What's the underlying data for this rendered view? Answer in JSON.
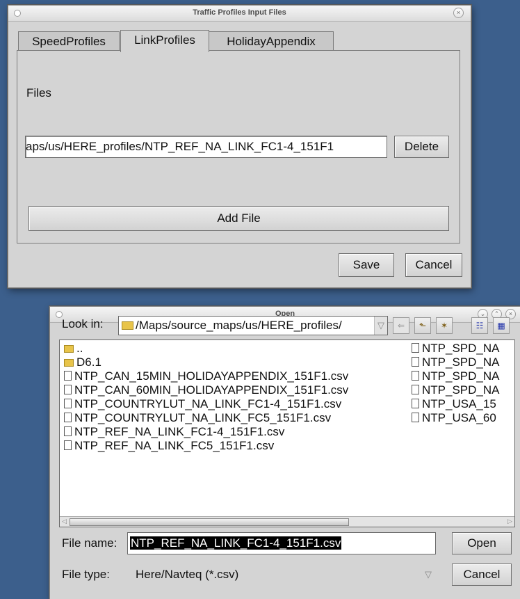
{
  "profiles_window": {
    "title": "Traffic Profiles Input Files",
    "tabs": [
      {
        "label": "SpeedProfiles",
        "active": false
      },
      {
        "label": "LinkProfiles",
        "active": true
      },
      {
        "label": "HolidayAppendix",
        "active": false
      }
    ],
    "files_heading": "Files",
    "file_path_value": "aps/us/HERE_profiles/NTP_REF_NA_LINK_FC1-4_151F1",
    "delete_label": "Delete",
    "add_file_label": "Add File",
    "save_label": "Save",
    "cancel_label": "Cancel",
    "close_glyph": "×"
  },
  "open_dialog": {
    "title": "Open",
    "look_in_label": "Look in:",
    "look_in_value": "/Maps/source_maps/us/HERE_profiles/",
    "toolbar_icons": [
      "back-icon",
      "up-folder-icon",
      "new-folder-icon",
      "list-view-icon",
      "detail-view-icon"
    ],
    "files_col1": [
      {
        "name": "..",
        "type": "folder"
      },
      {
        "name": "D6.1",
        "type": "folder"
      },
      {
        "name": "NTP_CAN_15MIN_HOLIDAYAPPENDIX_151F1.csv",
        "type": "file"
      },
      {
        "name": "NTP_CAN_60MIN_HOLIDAYAPPENDIX_151F1.csv",
        "type": "file"
      },
      {
        "name": "NTP_COUNTRYLUT_NA_LINK_FC1-4_151F1.csv",
        "type": "file"
      },
      {
        "name": "NTP_COUNTRYLUT_NA_LINK_FC5_151F1.csv",
        "type": "file"
      },
      {
        "name": "NTP_REF_NA_LINK_FC1-4_151F1.csv",
        "type": "file"
      },
      {
        "name": "NTP_REF_NA_LINK_FC5_151F1.csv",
        "type": "file"
      }
    ],
    "files_col2": [
      {
        "name": "NTP_SPD_NA",
        "type": "file"
      },
      {
        "name": "NTP_SPD_NA",
        "type": "file"
      },
      {
        "name": "NTP_SPD_NA",
        "type": "file"
      },
      {
        "name": "NTP_SPD_NA",
        "type": "file"
      },
      {
        "name": "NTP_USA_15",
        "type": "file"
      },
      {
        "name": "NTP_USA_60",
        "type": "file"
      }
    ],
    "file_name_label": "File name:",
    "file_name_value": "NTP_REF_NA_LINK_FC1-4_151F1.csv",
    "file_type_label": "File type:",
    "file_type_value": "Here/Navteq (*.csv)",
    "open_label": "Open",
    "cancel_label": "Cancel"
  }
}
